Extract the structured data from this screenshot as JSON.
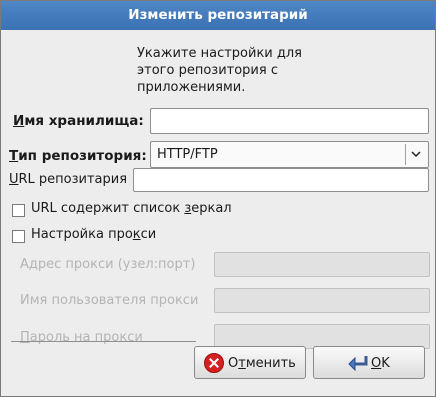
{
  "window": {
    "title": "Изменить репозитарий"
  },
  "intro_text": "Укажите настройки для\nэтого репозитория с\nприложениями.",
  "repo_name": {
    "label_prefix": "И",
    "label_rest": "мя хранилища:",
    "value": ""
  },
  "repo_type": {
    "label_prefix": "Т",
    "label_rest": "ип репозитория:",
    "selected": "HTTP/FTP"
  },
  "repo_url": {
    "label_prefix": "U",
    "label_rest": "RL репозитария",
    "value": ""
  },
  "mirror_list": {
    "label_pre": "URL содержит список ",
    "label_u": "з",
    "label_post": "еркал",
    "checked": false
  },
  "proxy": {
    "label_pre": "Настройка про",
    "label_u": "к",
    "label_post": "си",
    "checked": false
  },
  "proxy_address": {
    "label": "Адрес прокси (узел:порт)",
    "value": ""
  },
  "proxy_user": {
    "label": "Имя пользователя прокси",
    "value": ""
  },
  "proxy_password": {
    "label_prefix": "П",
    "label_rest": "ароль на прокси",
    "value": ""
  },
  "buttons": {
    "cancel": {
      "pre": "О",
      "u": "т",
      "post": "менить"
    },
    "ok": {
      "u": "O",
      "post": "K"
    }
  }
}
